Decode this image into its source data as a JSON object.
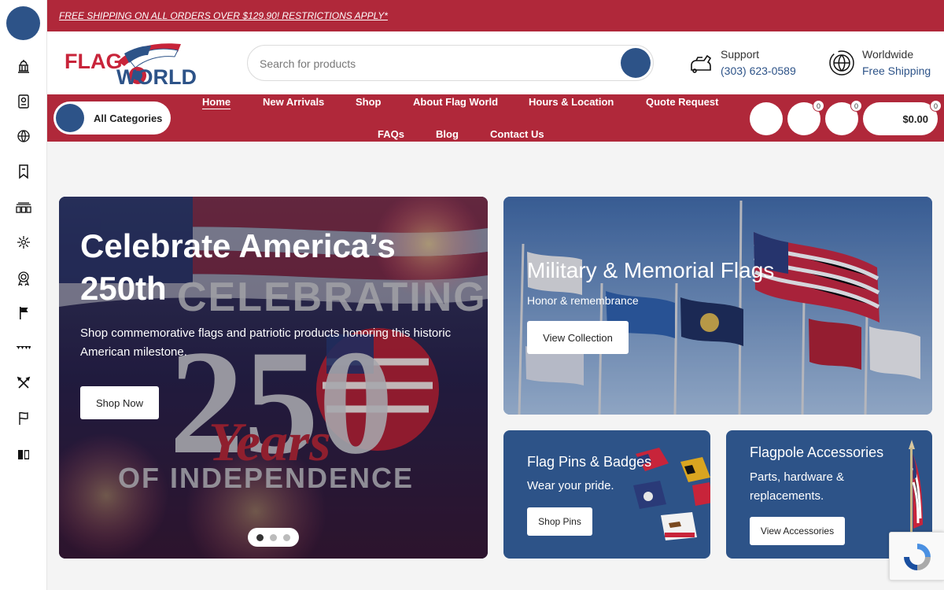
{
  "promo": {
    "text": "FREE SHIPPING ON ALL ORDERS OVER $129.90! RESTRICTIONS APPLY*"
  },
  "header": {
    "logo_text_top": "FLAG",
    "logo_text_bottom": "WORLD",
    "search_placeholder": "Search for products",
    "support_label": "Support",
    "support_phone": "(303) 623-0589",
    "shipping_label": "Worldwide",
    "shipping_link": "Free Shipping"
  },
  "nav": {
    "categories_label": "All Categories",
    "links": [
      "Home",
      "New Arrivals",
      "Shop",
      "About Flag World",
      "Hours & Location",
      "Quote Request",
      "FAQs",
      "Blog",
      "Contact Us"
    ],
    "compare_count": "0",
    "wishlist_count": "0",
    "cart_count": "0",
    "cart_total": "$0.00"
  },
  "hero": {
    "title": "Celebrate America’s 250th",
    "subtitle": "Shop commemorative flags and patriotic products honoring this historic American milestone.",
    "button": "Shop Now",
    "art_line1": "CELEBRATING",
    "art_number": "250",
    "art_script": "Years",
    "art_line3": "OF INDEPENDENCE"
  },
  "tiles": {
    "military": {
      "title": "Military & Memorial Flags",
      "subtitle": "Honor & remembrance",
      "button": "View Collection"
    },
    "pins": {
      "title": "Flag Pins & Badges",
      "subtitle": "Wear your pride.",
      "button": "Shop Pins"
    },
    "accessories": {
      "title": "Flagpole Accessories",
      "subtitle": "Parts, hardware & replacements.",
      "button": "View Accessories"
    }
  },
  "colors": {
    "brand_red": "#b0283a",
    "brand_blue": "#2d5388",
    "background": "#f4f4f4"
  },
  "rail_icons": [
    "capitol-icon",
    "badge-card-icon",
    "globe-icon",
    "bookmark-ribbon-icon",
    "bunting-flags-icon",
    "firework-icon",
    "medal-icon",
    "flag-on-pole-icon",
    "pennant-string-icon",
    "crossed-tools-icon",
    "waving-flag-icon",
    "book-icon"
  ]
}
